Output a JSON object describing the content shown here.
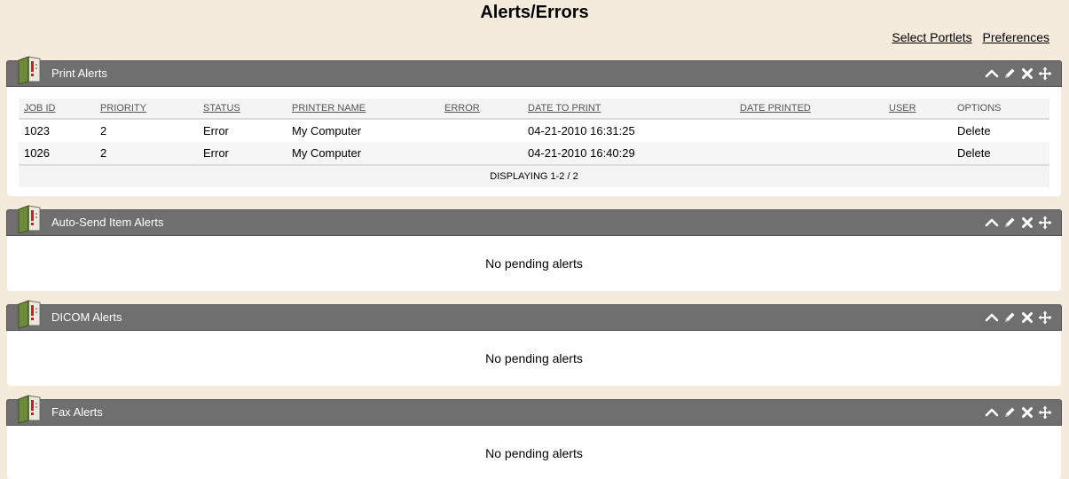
{
  "page": {
    "title": "Alerts/Errors",
    "links": [
      "Select Portlets",
      "Preferences"
    ]
  },
  "portlets": [
    {
      "title": "Print Alerts",
      "columns": [
        "JOB ID",
        "PRIORITY",
        "STATUS",
        "PRINTER NAME",
        "ERROR",
        "DATE TO PRINT",
        "DATE PRINTED",
        "USER",
        "OPTIONS"
      ],
      "rows": [
        {
          "job_id": "1023",
          "priority": "2",
          "status": "Error",
          "printer": "My Computer",
          "error": "",
          "date_to_print": "04-21-2010 16:31:25",
          "date_printed": "",
          "user": "",
          "option": "Delete"
        },
        {
          "job_id": "1026",
          "priority": "2",
          "status": "Error",
          "printer": "My Computer",
          "error": "",
          "date_to_print": "04-21-2010 16:40:29",
          "date_printed": "",
          "user": "",
          "option": "Delete"
        }
      ],
      "footer": "DISPLAYING 1-2 / 2"
    },
    {
      "title": "Auto-Send Item Alerts",
      "message": "No pending alerts"
    },
    {
      "title": "DICOM Alerts",
      "message": "No pending alerts"
    },
    {
      "title": "Fax Alerts",
      "message": "No pending alerts"
    }
  ],
  "icons": {
    "portlet": "alert-book-icon",
    "controls": [
      "collapse-icon",
      "edit-icon",
      "close-icon",
      "move-icon"
    ]
  },
  "colors": {
    "background": "#f4ebdc",
    "header": "#6f6f6f",
    "alert_red": "#cc1f1f",
    "book_green": "#6e8b3d"
  }
}
